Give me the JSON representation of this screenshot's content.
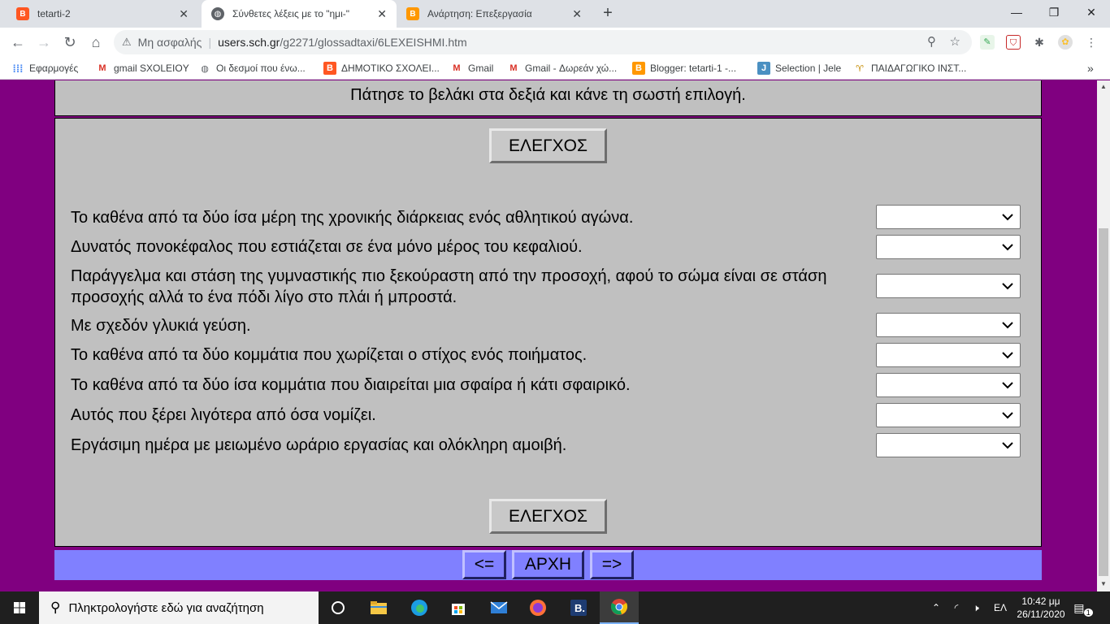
{
  "browser": {
    "tabs": [
      {
        "title": "tetarti-2",
        "active": false,
        "favicon": "blogger-icon"
      },
      {
        "title": "Σύνθετες λέξεις με το \"ημι-\"",
        "active": true,
        "favicon": "globe-icon"
      },
      {
        "title": "Ανάρτηση: Επεξεργασία",
        "active": false,
        "favicon": "blogger-icon"
      }
    ],
    "omnibox": {
      "security": "Μη ασφαλής",
      "host": "users.sch.gr",
      "path": "/g2271/glossadtaxi/6LEXEISHMI.htm"
    },
    "bookmarks": [
      {
        "label": "Εφαρμογές",
        "icon": "apps-grid-icon"
      },
      {
        "label": "gmail SXOLEIOY",
        "icon": "gmail-icon"
      },
      {
        "label": "Οι δεσμοί που ένω...",
        "icon": "globe-icon"
      },
      {
        "label": "ΔΗΜΟΤΙΚΟ ΣΧΟΛΕΙ...",
        "icon": "blogger-icon"
      },
      {
        "label": "Gmail",
        "icon": "gmail-icon"
      },
      {
        "label": "Gmail - Δωρεάν χώ...",
        "icon": "gmail-icon"
      },
      {
        "label": "Blogger: tetarti-1 -...",
        "icon": "blogger-icon"
      },
      {
        "label": "Selection | Jele",
        "icon": "j-icon"
      },
      {
        "label": "ΠΑΙΔΑΓΩΓΙΚΟ ΙΝΣΤ...",
        "icon": "pi-icon"
      }
    ],
    "bookmarks_more": "»"
  },
  "page": {
    "instruction": "Πάτησε το βελάκι στα δεξιά και κάνε τη σωστή επιλογή.",
    "check_label_top": "ΕΛΕΓΧΟΣ",
    "check_label_bottom": "ΕΛΕΓΧΟΣ",
    "questions": [
      {
        "text": "Το καθένα από τα δύο ίσα μέρη της χρονικής διάρκειας ενός αθλητικού αγώνα.",
        "selected": ""
      },
      {
        "text": "Δυνατός πονοκέφαλος που εστιάζεται σε ένα μόνο μέρος του κεφαλιού.",
        "selected": ""
      },
      {
        "text": "Παράγγελμα και στάση της γυμναστικής πιο ξεκούραστη από την προσοχή, αφού το σώμα είναι σε στάση προσοχής αλλά το ένα πόδι λίγο στο πλάι ή μπροστά.",
        "selected": ""
      },
      {
        "text": "Με σχεδόν γλυκιά γεύση.",
        "selected": ""
      },
      {
        "text": "Το καθένα από τα δύο κομμάτια που χωρίζεται ο στίχος ενός ποιήματος.",
        "selected": ""
      },
      {
        "text": "Το καθένα από τα δύο ίσα κομμάτια που διαιρείται μια σφαίρα ή κάτι σφαιρικό.",
        "selected": ""
      },
      {
        "text": "Αυτός που ξέρει λιγότερα από όσα νομίζει.",
        "selected": ""
      },
      {
        "text": "Εργάσιμη ημέρα με μειωμένο ωράριο εργασίας και ολόκληρη αμοιβή.",
        "selected": ""
      }
    ],
    "nav": {
      "prev": "<=",
      "home": "ΑΡΧΗ",
      "next": "=>"
    }
  },
  "taskbar": {
    "search_placeholder": "Πληκτρολογήστε εδώ για αναζήτηση",
    "language": "ΕΛ",
    "time": "10:42 μμ",
    "date": "26/11/2020",
    "notification_count": "1"
  },
  "colors": {
    "page_background": "#800080",
    "panel": "#c0c0c0",
    "nav_bar": "#8080ff"
  }
}
